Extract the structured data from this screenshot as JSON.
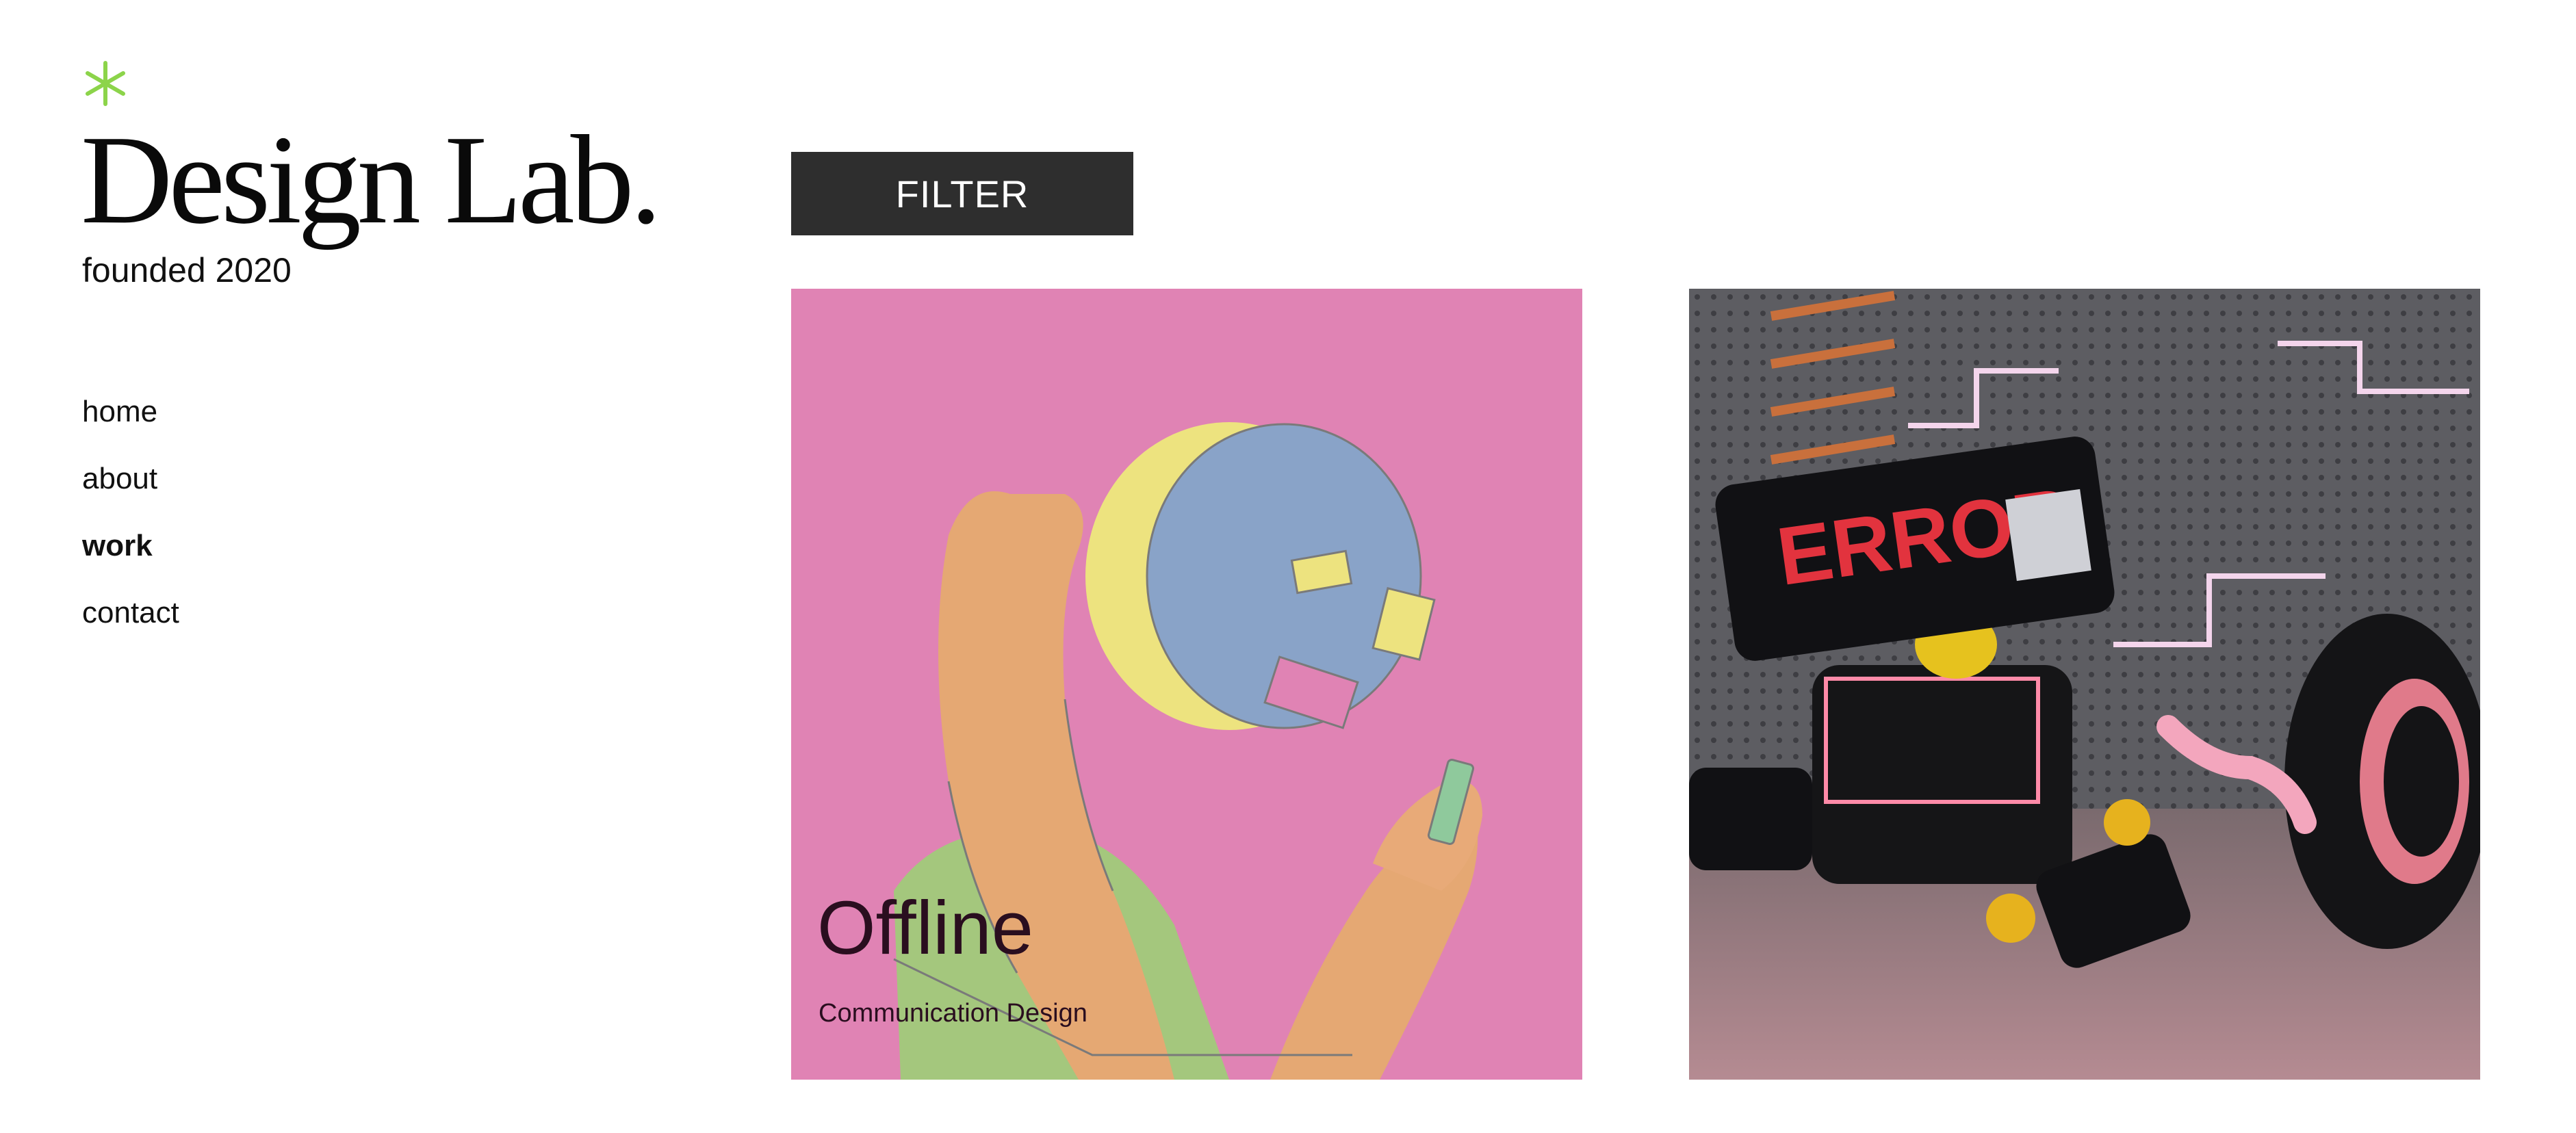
{
  "brand": {
    "title": "Design Lab.",
    "subtitle": "founded 2020",
    "accent_color": "#8cd44a",
    "icon": "asterisk-icon"
  },
  "nav": {
    "items": [
      {
        "label": "home",
        "active": false
      },
      {
        "label": "about",
        "active": false
      },
      {
        "label": "work",
        "active": true
      },
      {
        "label": "contact",
        "active": false
      }
    ]
  },
  "filter": {
    "label": "FILTER",
    "color": "#2e2e2e"
  },
  "projects": [
    {
      "title": "Offline",
      "category": "Communication Design",
      "image": "illustration of person with lamp-shaped head looking at phone",
      "background": "#e083b4"
    },
    {
      "image": "robot with ERROR sign on its head",
      "background": "#5f5f64"
    }
  ]
}
